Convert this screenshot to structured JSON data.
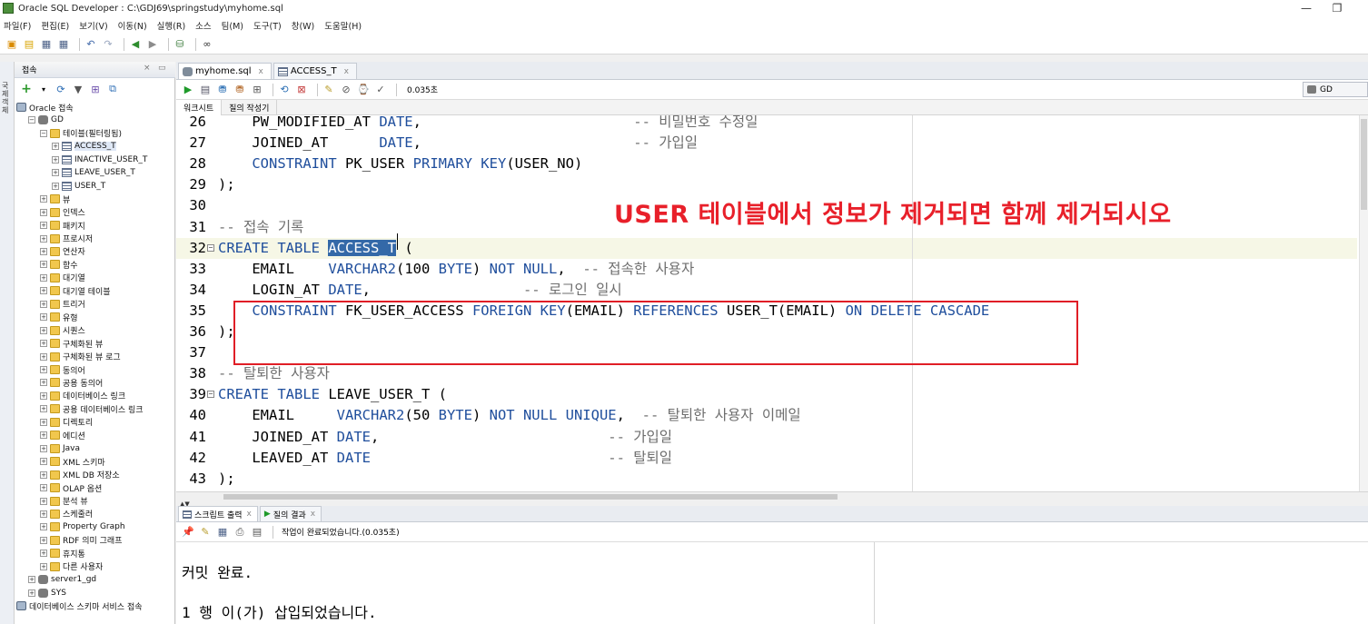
{
  "window": {
    "title": "Oracle SQL Developer : C:\\GDJ69\\springstudy\\myhome.sql",
    "minimize": "—",
    "maximize": "❐"
  },
  "menu": [
    "파일(F)",
    "편집(E)",
    "보기(V)",
    "이동(N)",
    "실행(R)",
    "소스",
    "팀(M)",
    "도구(T)",
    "창(W)",
    "도움말(H)"
  ],
  "connections_panel": {
    "title": "접속",
    "vertical_tab": "국제 객체",
    "tree": [
      {
        "label": "Oracle 접속",
        "icon": "connection-folder-icon",
        "level": 0,
        "expanded": true
      },
      {
        "label": "GD",
        "icon": "database-icon",
        "level": 1,
        "expanded": true
      },
      {
        "label": "테이블(필터링됨)",
        "icon": "folder-icon",
        "level": 2,
        "expanded": true
      },
      {
        "label": "ACCESS_T",
        "icon": "table-icon",
        "level": 3,
        "selected": true
      },
      {
        "label": "INACTIVE_USER_T",
        "icon": "table-icon",
        "level": 3
      },
      {
        "label": "LEAVE_USER_T",
        "icon": "table-icon",
        "level": 3
      },
      {
        "label": "USER_T",
        "icon": "table-icon",
        "level": 3
      },
      {
        "label": "뷰",
        "icon": "folder-icon",
        "level": 2
      },
      {
        "label": "인덱스",
        "icon": "folder-icon",
        "level": 2
      },
      {
        "label": "패키지",
        "icon": "folder-icon",
        "level": 2
      },
      {
        "label": "프로시저",
        "icon": "folder-icon",
        "level": 2
      },
      {
        "label": "연산자",
        "icon": "folder-icon",
        "level": 2
      },
      {
        "label": "함수",
        "icon": "folder-icon",
        "level": 2
      },
      {
        "label": "대기열",
        "icon": "folder-icon",
        "level": 2
      },
      {
        "label": "대기열 테이블",
        "icon": "folder-icon",
        "level": 2
      },
      {
        "label": "트리거",
        "icon": "folder-icon",
        "level": 2
      },
      {
        "label": "유형",
        "icon": "folder-icon",
        "level": 2
      },
      {
        "label": "시퀀스",
        "icon": "folder-icon",
        "level": 2
      },
      {
        "label": "구체화된 뷰",
        "icon": "folder-icon",
        "level": 2
      },
      {
        "label": "구체화된 뷰 로그",
        "icon": "folder-icon",
        "level": 2
      },
      {
        "label": "동의어",
        "icon": "folder-icon",
        "level": 2
      },
      {
        "label": "공용 동의어",
        "icon": "folder-icon",
        "level": 2
      },
      {
        "label": "데이터베이스 링크",
        "icon": "folder-icon",
        "level": 2
      },
      {
        "label": "공용 데이터베이스 링크",
        "icon": "folder-icon",
        "level": 2
      },
      {
        "label": "디렉토리",
        "icon": "folder-icon",
        "level": 2
      },
      {
        "label": "에디션",
        "icon": "folder-icon",
        "level": 2
      },
      {
        "label": "Java",
        "icon": "folder-icon",
        "level": 2
      },
      {
        "label": "XML 스키마",
        "icon": "folder-icon",
        "level": 2
      },
      {
        "label": "XML DB 저장소",
        "icon": "folder-icon",
        "level": 2
      },
      {
        "label": "OLAP 옵션",
        "icon": "folder-icon",
        "level": 2
      },
      {
        "label": "분석 뷰",
        "icon": "folder-icon",
        "level": 2
      },
      {
        "label": "스케줄러",
        "icon": "folder-icon",
        "level": 2
      },
      {
        "label": "Property Graph",
        "icon": "folder-icon",
        "level": 2
      },
      {
        "label": "RDF 의미 그래프",
        "icon": "folder-icon",
        "level": 2
      },
      {
        "label": "휴지통",
        "icon": "folder-icon",
        "level": 2
      },
      {
        "label": "다른 사용자",
        "icon": "folder-icon",
        "level": 2
      },
      {
        "label": "server1_gd",
        "icon": "database-icon",
        "level": 1
      },
      {
        "label": "SYS",
        "icon": "database-icon",
        "level": 1
      },
      {
        "label": "데이터베이스 스키마 서비스 접속",
        "icon": "cloud-icon",
        "level": 0
      }
    ]
  },
  "editor_tabs": [
    {
      "label": "myhome.sql",
      "active": true
    },
    {
      "label": "ACCESS_T",
      "active": false
    }
  ],
  "editor_toolbar": {
    "timing": "0.035초",
    "connection": "GD"
  },
  "sub_tabs": [
    "워크시트",
    "질의 작성기"
  ],
  "code_lines": [
    {
      "n": "26",
      "parts": [
        [
          "t",
          "    PW_MODIFIED_AT "
        ],
        [
          "k",
          "DATE"
        ],
        [
          "t",
          ",                         "
        ],
        [
          "c",
          "-- 비밀번호 수정일"
        ]
      ]
    },
    {
      "n": "27",
      "parts": [
        [
          "t",
          "    JOINED_AT      "
        ],
        [
          "k",
          "DATE"
        ],
        [
          "t",
          ",                         "
        ],
        [
          "c",
          "-- 가입일"
        ]
      ]
    },
    {
      "n": "28",
      "parts": [
        [
          "t",
          "    "
        ],
        [
          "k",
          "CONSTRAINT"
        ],
        [
          "t",
          " PK_USER "
        ],
        [
          "k",
          "PRIMARY KEY"
        ],
        [
          "t",
          "(USER_NO)"
        ]
      ]
    },
    {
      "n": "29",
      "parts": [
        [
          "t",
          ");"
        ]
      ]
    },
    {
      "n": "30",
      "parts": []
    },
    {
      "n": "31",
      "parts": [
        [
          "c",
          "-- 접속 기록"
        ]
      ]
    },
    {
      "n": "32",
      "fold": true,
      "current": true,
      "parts": [
        [
          "k",
          "CREATE TABLE"
        ],
        [
          "t",
          " "
        ],
        [
          "s",
          "ACCESS_T"
        ],
        [
          "t",
          " ("
        ]
      ]
    },
    {
      "n": "33",
      "parts": [
        [
          "t",
          "    EMAIL    "
        ],
        [
          "k",
          "VARCHAR2"
        ],
        [
          "t",
          "(100 "
        ],
        [
          "k",
          "BYTE"
        ],
        [
          "t",
          ") "
        ],
        [
          "k",
          "NOT NULL"
        ],
        [
          "t",
          ",  "
        ],
        [
          "c",
          "-- 접속한 사용자"
        ]
      ]
    },
    {
      "n": "34",
      "parts": [
        [
          "t",
          "    LOGIN_AT "
        ],
        [
          "k",
          "DATE"
        ],
        [
          "t",
          ",                  "
        ],
        [
          "c",
          "-- 로그인 일시"
        ]
      ]
    },
    {
      "n": "35",
      "parts": [
        [
          "t",
          "    "
        ],
        [
          "k",
          "CONSTRAINT"
        ],
        [
          "t",
          " FK_USER_ACCESS "
        ],
        [
          "k",
          "FOREIGN KEY"
        ],
        [
          "t",
          "(EMAIL) "
        ],
        [
          "k",
          "REFERENCES"
        ],
        [
          "t",
          " USER_T(EMAIL) "
        ],
        [
          "k",
          "ON DELETE CASCADE"
        ]
      ]
    },
    {
      "n": "36",
      "parts": [
        [
          "t",
          ");"
        ]
      ]
    },
    {
      "n": "37",
      "parts": []
    },
    {
      "n": "38",
      "parts": [
        [
          "c",
          "-- 탈퇴한 사용자"
        ]
      ]
    },
    {
      "n": "39",
      "fold": true,
      "parts": [
        [
          "k",
          "CREATE TABLE"
        ],
        [
          "t",
          " LEAVE_USER_T ("
        ]
      ]
    },
    {
      "n": "40",
      "parts": [
        [
          "t",
          "    EMAIL     "
        ],
        [
          "k",
          "VARCHAR2"
        ],
        [
          "t",
          "(50 "
        ],
        [
          "k",
          "BYTE"
        ],
        [
          "t",
          ") "
        ],
        [
          "k",
          "NOT NULL UNIQUE"
        ],
        [
          "t",
          ",  "
        ],
        [
          "c",
          "-- 탈퇴한 사용자 이메일"
        ]
      ]
    },
    {
      "n": "41",
      "parts": [
        [
          "t",
          "    JOINED_AT "
        ],
        [
          "k",
          "DATE"
        ],
        [
          "t",
          ",                           "
        ],
        [
          "c",
          "-- 가입일"
        ]
      ]
    },
    {
      "n": "42",
      "parts": [
        [
          "t",
          "    LEAVED_AT "
        ],
        [
          "k",
          "DATE"
        ],
        [
          "t",
          "                            "
        ],
        [
          "c",
          "-- 탈퇴일"
        ]
      ]
    },
    {
      "n": "43",
      "parts": [
        [
          "t",
          ");"
        ]
      ]
    }
  ],
  "annotation": "USER 테이블에서 정보가 제거되면 함께 제거되시오",
  "bottom_tabs": [
    {
      "label": "스크립트 출력",
      "active": true
    },
    {
      "label": "질의 결과",
      "active": false
    }
  ],
  "bottom_status": "작업이 완료되었습니다.(0.035초)",
  "output_lines": [
    "커밋 완료.",
    "1 행 이(가) 삽입되었습니다."
  ],
  "tab_close": "x",
  "colors": {
    "keyword": "#1f4e9c",
    "comment": "#6e6e6e",
    "annotation": "#e8202a",
    "selection": "#3469a8"
  }
}
